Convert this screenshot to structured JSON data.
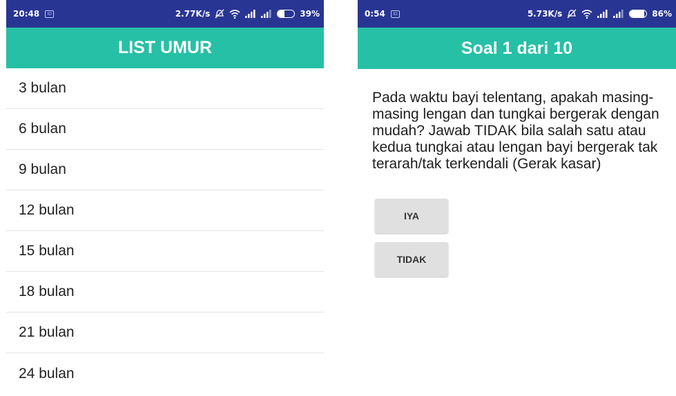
{
  "left_screen": {
    "status_bar": {
      "time": "20:48",
      "speed": "2.77K/s",
      "battery": "39%",
      "battery_level": 0.39,
      "icons": [
        "notification-icon",
        "alarm-off-icon",
        "wifi-icon",
        "signal-icon",
        "signal-icon",
        "battery-icon"
      ]
    },
    "app_bar": {
      "title": "LIST UMUR"
    },
    "items": [
      {
        "label": "3 bulan"
      },
      {
        "label": "6 bulan"
      },
      {
        "label": "9 bulan"
      },
      {
        "label": "12 bulan"
      },
      {
        "label": "15 bulan"
      },
      {
        "label": "18 bulan"
      },
      {
        "label": "21 bulan"
      },
      {
        "label": "24 bulan"
      }
    ]
  },
  "right_screen": {
    "status_bar": {
      "time": "0:54",
      "speed": "5.73K/s",
      "battery": "86%",
      "battery_level": 0.86,
      "icons": [
        "notification-icon",
        "alarm-off-icon",
        "wifi-icon",
        "signal-icon",
        "signal-icon",
        "battery-icon"
      ]
    },
    "app_bar": {
      "title": "Soal 1 dari 10"
    },
    "question": "Pada waktu bayi telentang, apakah masing-masing lengan dan tungkai bergerak dengan mudah? Jawab TIDAK bila salah satu atau kedua tungkai atau lengan bayi bergerak tak terarah/tak terkendali (Gerak kasar)",
    "buttons": {
      "yes": "IYA",
      "no": "TIDAK"
    }
  },
  "colors": {
    "status_bar": "#283593",
    "app_bar": "#26c0a6",
    "button": "#e0e0e0"
  }
}
